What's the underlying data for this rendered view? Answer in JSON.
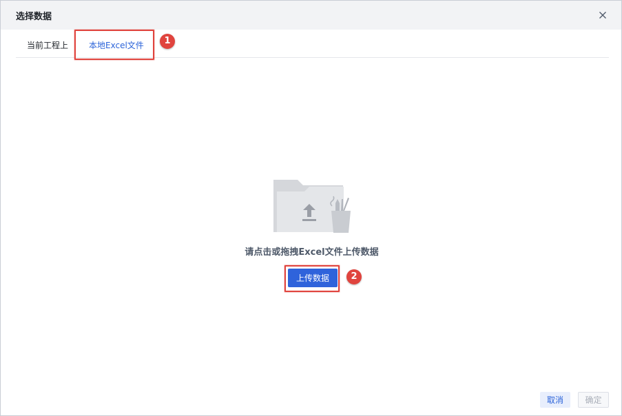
{
  "dialog": {
    "title": "选择数据",
    "close_icon": "close-icon"
  },
  "tabs": [
    {
      "label": "当前工程上",
      "active": false
    },
    {
      "label": "本地Excel文件",
      "active": true
    }
  ],
  "annotations": [
    {
      "number": "1"
    },
    {
      "number": "2"
    }
  ],
  "upload": {
    "illustration_icon": "folder-upload-icon",
    "hint": "请点击或拖拽Excel文件上传数据",
    "button_label": "上传数据"
  },
  "footer": {
    "cancel_label": "取消",
    "confirm_label": "确定",
    "confirm_disabled": true
  },
  "colors": {
    "accent": "#2f63db",
    "annotation_red": "#e0443e",
    "title_bar": "#f2f3f5"
  }
}
